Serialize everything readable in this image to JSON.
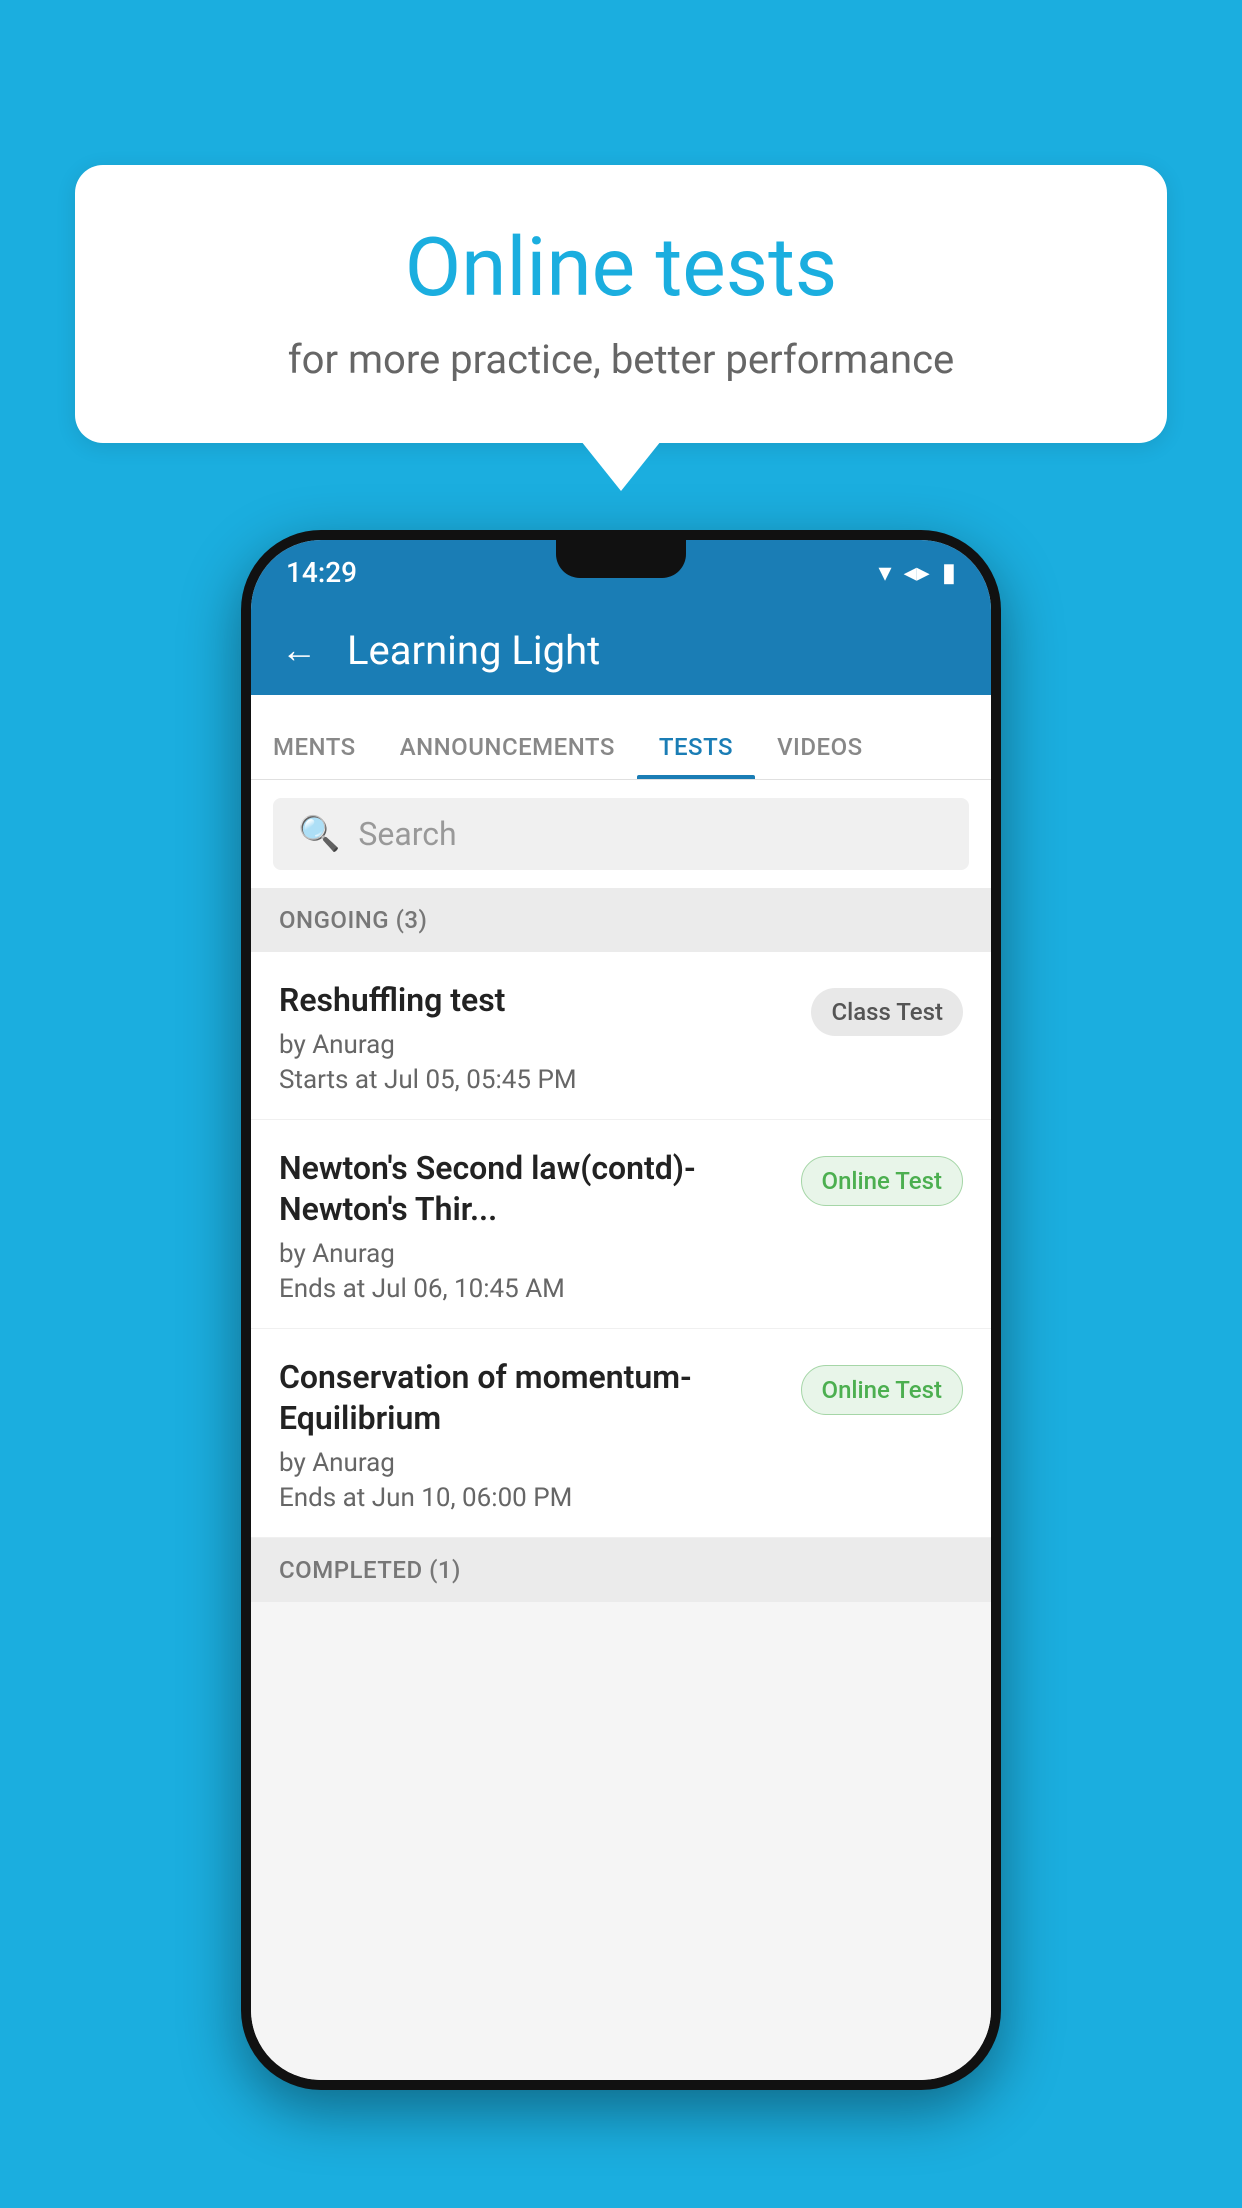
{
  "background_color": "#1BAEDF",
  "speech_bubble": {
    "title": "Online tests",
    "subtitle": "for more practice, better performance"
  },
  "phone": {
    "status_bar": {
      "time": "14:29",
      "icons": [
        "▼",
        "▲",
        "▉"
      ]
    },
    "app_header": {
      "back_label": "←",
      "title": "Learning Light"
    },
    "tabs": [
      {
        "label": "MENTS",
        "active": false
      },
      {
        "label": "ANNOUNCEMENTS",
        "active": false
      },
      {
        "label": "TESTS",
        "active": true
      },
      {
        "label": "VIDEOS",
        "active": false
      }
    ],
    "search": {
      "placeholder": "Search",
      "icon": "🔍"
    },
    "ongoing_section": {
      "title": "ONGOING (3)",
      "tests": [
        {
          "name": "Reshuffling test",
          "author": "by Anurag",
          "date": "Starts at  Jul 05, 05:45 PM",
          "badge": "Class Test",
          "badge_type": "class"
        },
        {
          "name": "Newton's Second law(contd)-Newton's Thir...",
          "author": "by Anurag",
          "date": "Ends at  Jul 06, 10:45 AM",
          "badge": "Online Test",
          "badge_type": "online"
        },
        {
          "name": "Conservation of momentum-Equilibrium",
          "author": "by Anurag",
          "date": "Ends at  Jun 10, 06:00 PM",
          "badge": "Online Test",
          "badge_type": "online"
        }
      ]
    },
    "completed_section": {
      "title": "COMPLETED (1)"
    }
  }
}
